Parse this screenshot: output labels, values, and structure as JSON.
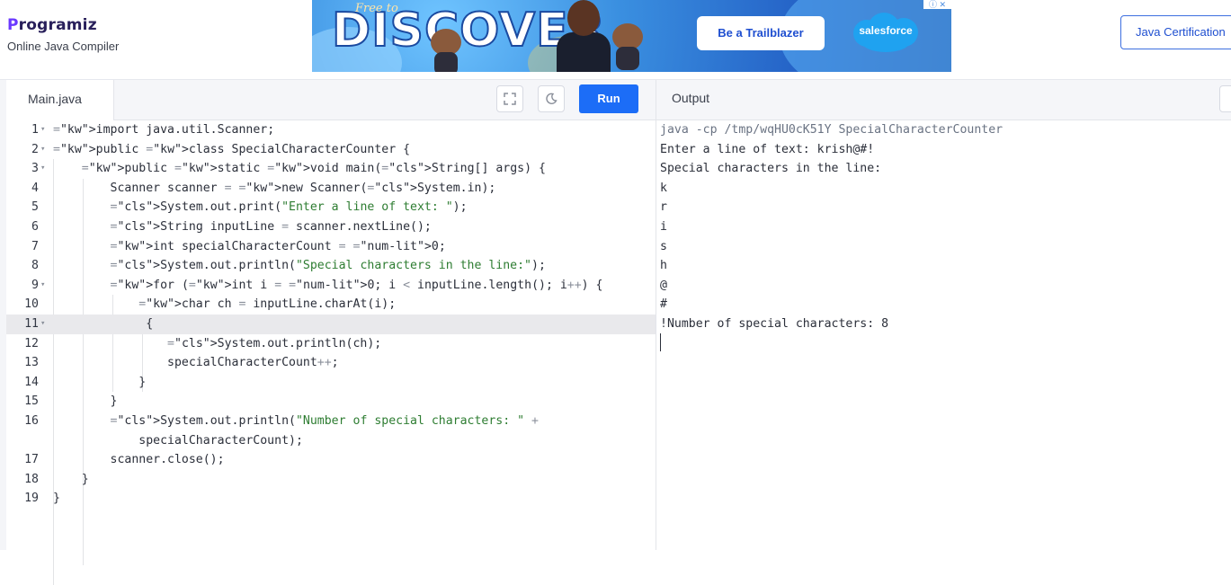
{
  "header": {
    "logo": "Programiz",
    "logo_first": "P",
    "logo_rest": "rogramiz",
    "subtitle": "Online Java Compiler",
    "cert_button": "Java Certification"
  },
  "ad": {
    "tagline": "Free to",
    "headline": "DISCOVER",
    "cta": "Be a Trailblazer",
    "brand": "salesforce",
    "close": "ⓘ ✕"
  },
  "editor": {
    "tab": "Main.java",
    "run_label": "Run",
    "fullscreen_icon": "expand-icon",
    "theme_icon": "moon-icon",
    "lines": [
      {
        "n": "1",
        "fold": true
      },
      {
        "n": "2",
        "fold": true
      },
      {
        "n": "3",
        "fold": true
      },
      {
        "n": "4",
        "fold": false
      },
      {
        "n": "5",
        "fold": false
      },
      {
        "n": "6",
        "fold": false
      },
      {
        "n": "7",
        "fold": false
      },
      {
        "n": "8",
        "fold": false
      },
      {
        "n": "9",
        "fold": true
      },
      {
        "n": "10",
        "fold": false
      },
      {
        "n": "11",
        "fold": true
      },
      {
        "n": "12",
        "fold": false
      },
      {
        "n": "13",
        "fold": false
      },
      {
        "n": "14",
        "fold": false
      },
      {
        "n": "15",
        "fold": false
      },
      {
        "n": "16",
        "fold": false
      },
      {
        "n": "",
        "fold": false
      },
      {
        "n": "17",
        "fold": false
      },
      {
        "n": "18",
        "fold": false
      },
      {
        "n": "19",
        "fold": false
      }
    ],
    "code": [
      "import java.util.Scanner;",
      "public class SpecialCharacterCounter {",
      "    public static void main(String[] args) {",
      "        Scanner scanner = new Scanner(System.in);",
      "        System.out.print(\"Enter a line of text: \");",
      "        String inputLine = scanner.nextLine();",
      "        int specialCharacterCount = 0;",
      "        System.out.println(\"Special characters in the line:\");",
      "        for (int i = 0; i < inputLine.length(); i++) {",
      "            char ch = inputLine.charAt(i);",
      "             {",
      "                System.out.println(ch);",
      "                specialCharacterCount++;",
      "            }",
      "        }",
      "        System.out.println(\"Number of special characters: \" +",
      "            specialCharacterCount);",
      "        scanner.close();",
      "    }",
      "}"
    ]
  },
  "output": {
    "label": "Output",
    "lines": [
      "java -cp /tmp/wqHU0cK51Y SpecialCharacterCounter",
      "Enter a line of text: krish@#!",
      "Special characters in the line:",
      "k",
      "r",
      "i",
      "s",
      "h",
      "@",
      "#",
      "!Number of special characters: 8"
    ]
  }
}
